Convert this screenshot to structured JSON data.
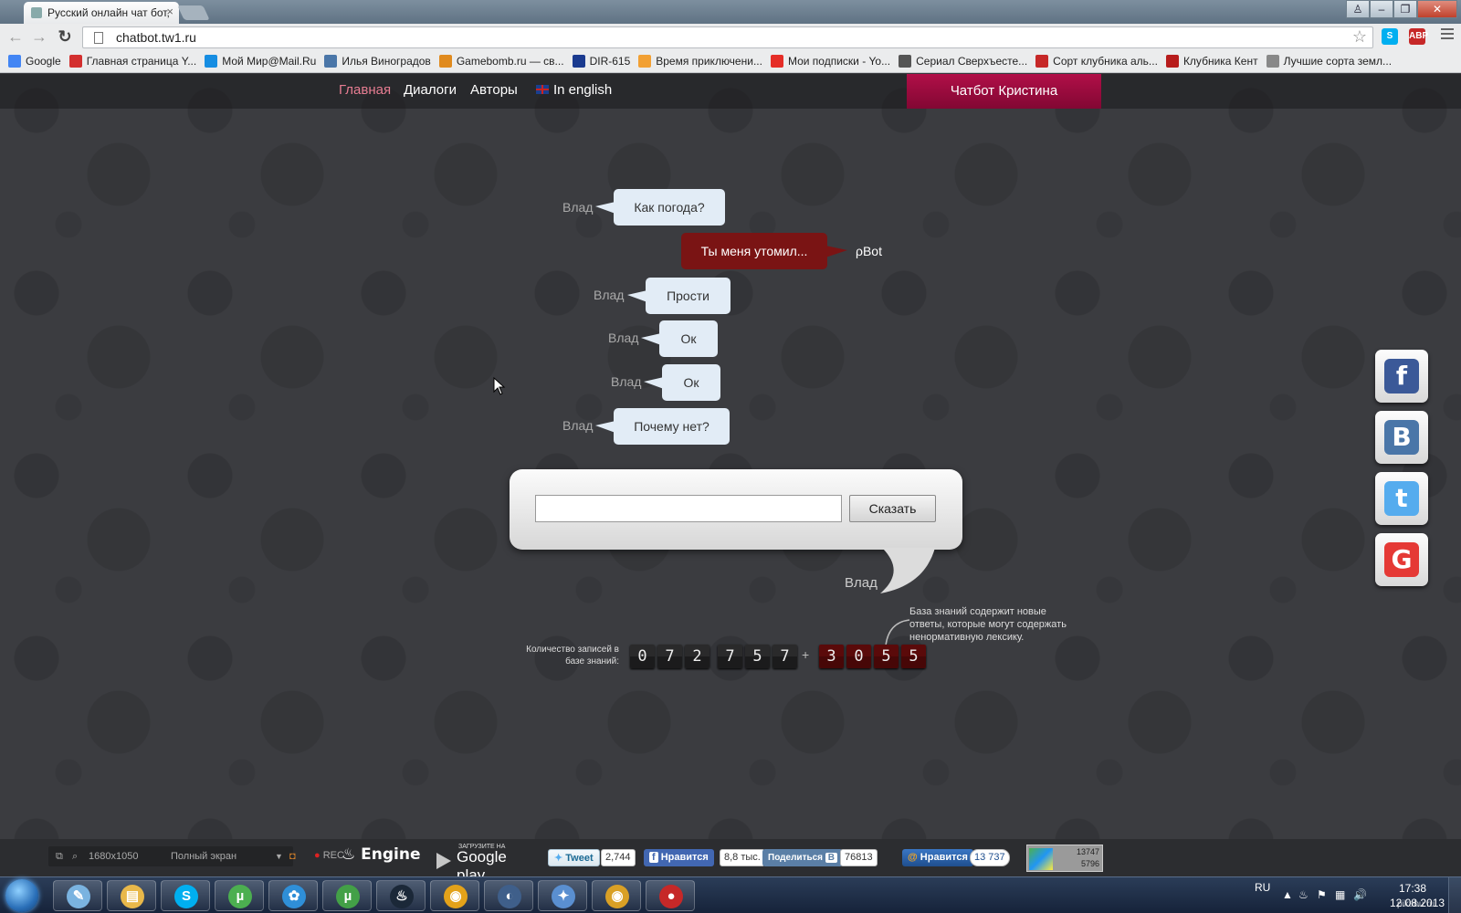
{
  "browser": {
    "tab_title": "Русский онлайн чат бот,",
    "url": "chatbot.tw1.ru",
    "bookmarks": [
      {
        "label": "Google",
        "color": "#4285f4"
      },
      {
        "label": "Главная страница Y...",
        "color": "#d32f2f"
      },
      {
        "label": "Мой Мир@Mail.Ru",
        "color": "#168de2"
      },
      {
        "label": "Илья Виноградов",
        "color": "#4a76a8"
      },
      {
        "label": "Gamebomb.ru — св...",
        "color": "#e08a1e"
      },
      {
        "label": "DIR-615",
        "color": "#1a3a8f"
      },
      {
        "label": "Время приключени...",
        "color": "#f2a033"
      },
      {
        "label": "Мои подписки - Yo...",
        "color": "#e52d27"
      },
      {
        "label": "Сериал Сверхъесте...",
        "color": "#555555"
      },
      {
        "label": "Сорт клубника аль...",
        "color": "#c62828"
      },
      {
        "label": "Клубника Кент",
        "color": "#b71c1c"
      },
      {
        "label": "Лучшие сорта земл...",
        "color": "#888888"
      }
    ]
  },
  "site": {
    "nav": {
      "home": "Главная",
      "dialogs": "Диалоги",
      "authors": "Авторы",
      "english": "In english",
      "kristina": "Чатбот Кристина"
    },
    "messages": [
      {
        "who": "Влад",
        "text": "Как погода?",
        "from": "user"
      },
      {
        "who": "ρBot",
        "text": "Ты меня утомил...",
        "from": "bot"
      },
      {
        "who": "Влад",
        "text": "Прости",
        "from": "user"
      },
      {
        "who": "Влад",
        "text": "Ок",
        "from": "user"
      },
      {
        "who": "Влад",
        "text": "Ок",
        "from": "user"
      },
      {
        "who": "Влад",
        "text": "Почему нет?",
        "from": "user"
      }
    ],
    "say": {
      "input_value": "",
      "button": "Сказать",
      "user_name": "Влад"
    },
    "counter": {
      "label": "Количество записей в базе знаний:",
      "main_digits": [
        "0",
        "7",
        "2",
        "7",
        "5",
        "7"
      ],
      "plus": "+",
      "new_digits": [
        "3",
        "0",
        "5",
        "5"
      ],
      "note": "База знаний содержит новые ответы, которые могут содержать ненормативную лексику."
    },
    "social": [
      {
        "name": "facebook",
        "glyph": "f",
        "color": "#3b5998"
      },
      {
        "name": "vkontakte",
        "glyph": "В",
        "color": "#4a76a8"
      },
      {
        "name": "twitter",
        "glyph": "t",
        "color": "#55acee"
      },
      {
        "name": "google-bookmarks",
        "glyph": "G",
        "color": "#e53935"
      }
    ]
  },
  "widgets": {
    "resolution": "1680x1050",
    "fullscreen": "Полный экран",
    "rec": "REC",
    "engine": "Engine",
    "gplay_small": "ЗАГРУЗИТЕ НА",
    "gplay_big": "Google play",
    "tweet": "Tweet",
    "tweet_count": "2,744",
    "fb_like": "Нравится",
    "fb_count": "8,8 тыс.",
    "vk_share": "Поделиться",
    "vk_count": "76813",
    "mail_like": "Нравится",
    "mail_count": "13 737",
    "counter_top": "13747",
    "counter_bottom": "5796"
  },
  "taskbar": {
    "apps": [
      {
        "name": "notepad",
        "glyph": "✎",
        "color": "#7ab3e0"
      },
      {
        "name": "explorer",
        "glyph": "▤",
        "color": "#e8b84a"
      },
      {
        "name": "skype",
        "glyph": "S",
        "color": "#00aff0"
      },
      {
        "name": "utorrent",
        "glyph": "µ",
        "color": "#4caf50"
      },
      {
        "name": "app-blue",
        "glyph": "✿",
        "color": "#2f8fd8"
      },
      {
        "name": "utorrent-2",
        "glyph": "µ",
        "color": "#43a047"
      },
      {
        "name": "steam",
        "glyph": "♨",
        "color": "#1b2838"
      },
      {
        "name": "chrome",
        "glyph": "◉",
        "color": "#e3a21a"
      },
      {
        "name": "media-app",
        "glyph": "◐",
        "color": "#3f5f8a"
      },
      {
        "name": "games-app",
        "glyph": "✦",
        "color": "#5a8fd0"
      },
      {
        "name": "chrome-active",
        "glyph": "◉",
        "color": "#d9a025"
      },
      {
        "name": "recorder",
        "glyph": "●",
        "color": "#c62828"
      }
    ],
    "lang": "RU",
    "time": "17:38",
    "date": "12.08.2013"
  },
  "watermark": "pikabu.ru"
}
